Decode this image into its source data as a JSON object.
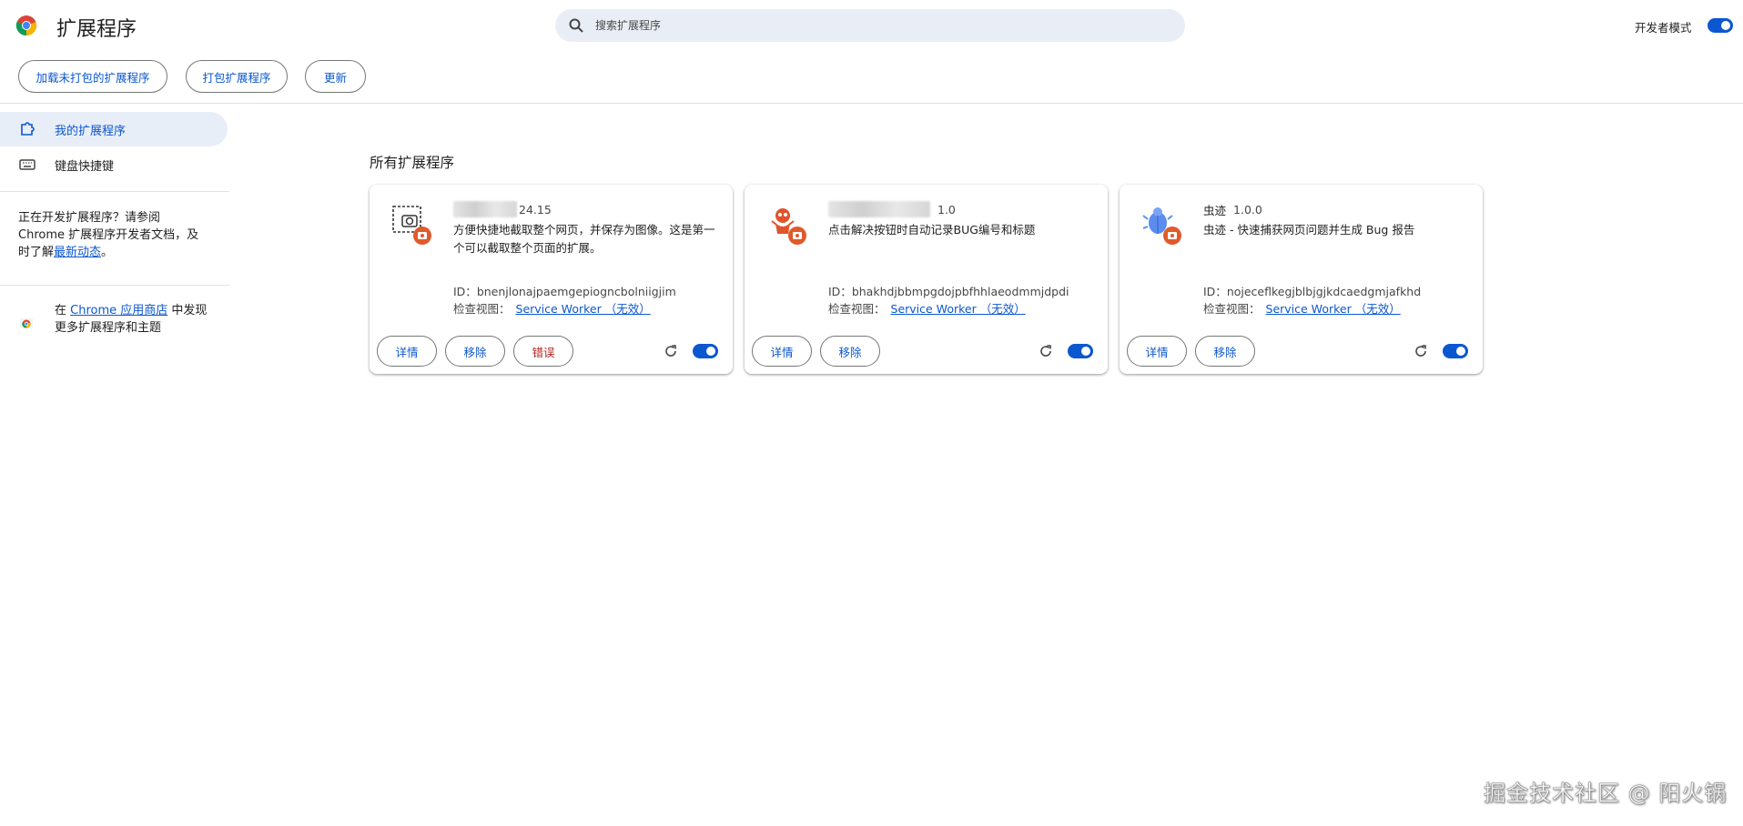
{
  "header": {
    "title": "扩展程序",
    "search_placeholder": "搜索扩展程序",
    "dev_mode_label": "开发者模式",
    "dev_mode_on": true
  },
  "toolbar": {
    "load_unpacked": "加载未打包的扩展程序",
    "pack": "打包扩展程序",
    "update": "更新"
  },
  "sidebar": {
    "items": [
      {
        "label": "我的扩展程序",
        "icon": "puzzle-icon",
        "active": true
      },
      {
        "label": "键盘快捷键",
        "icon": "keyboard-icon",
        "active": false
      }
    ],
    "dev_text_1": "正在开发扩展程序？请参阅 Chrome 扩展程序开发者文档，及时了解",
    "dev_link": "最新动态",
    "dev_text_2": "。",
    "store_prefix": "在",
    "store_link": "Chrome 应用商店",
    "store_suffix": "中发现更多扩展程序和主题"
  },
  "main": {
    "section_title": "所有扩展程序",
    "extensions": [
      {
        "name": "",
        "version": "24.15",
        "description": "方便快捷地截取整个网页，并保存为图像。这是第一个可以截取整个页面的扩展。",
        "id_label": "ID：",
        "id": "bnenjlonajpaemgepiogncbolniigjim",
        "inspect_label": "检查视图：",
        "inspect_link": "Service Worker （无效）",
        "buttons": [
          "详情",
          "移除",
          "错误"
        ],
        "enabled": true
      },
      {
        "name": "",
        "version": "1.0",
        "description": "点击解决按钮时自动记录BUG编号和标题",
        "id_label": "ID：",
        "id": "bhakhdjbbmpgdojpbfhhlaeodmmjdpdi",
        "inspect_label": "检查视图：",
        "inspect_link": "Service Worker （无效）",
        "buttons": [
          "详情",
          "移除"
        ],
        "enabled": true
      },
      {
        "name": "虫迹",
        "version": "1.0.0",
        "description": "虫迹 - 快速捕获网页问题并生成 Bug 报告",
        "id_label": "ID：",
        "id": "nojeceflkegjblbjgjkdcaedgmjafkhd",
        "inspect_label": "检查视图：",
        "inspect_link": "Service Worker （无效）",
        "buttons": [
          "详情",
          "移除"
        ],
        "enabled": true
      }
    ]
  },
  "watermark": "掘金技术社区 @ 阳火锅",
  "colors": {
    "accent": "#0b57d0",
    "error": "#b3261e",
    "active_bg": "#e8eef7"
  }
}
